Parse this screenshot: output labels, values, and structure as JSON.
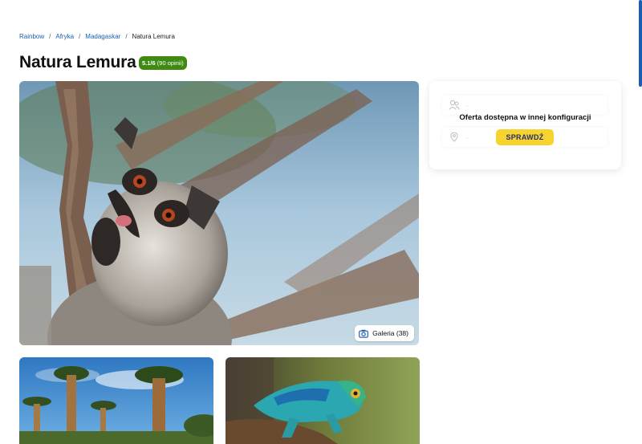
{
  "breadcrumb": {
    "items": [
      "Rainbow",
      "Afryka",
      "Madagaskar"
    ],
    "separator": "/",
    "current": "Natura Lemura"
  },
  "page": {
    "title": "Natura Lemura",
    "rating_score": "5.1/6",
    "rating_count": "(90 opinii)"
  },
  "gallery": {
    "button_label": "Galeria (38)",
    "icon": "camera-icon"
  },
  "offer": {
    "row1_placeholder": "-",
    "row2_placeholder": "-",
    "message": "Oferta dostępna w innej konfiguracji",
    "button_label": "SPRAWDŹ",
    "icons": [
      "people-icon",
      "location-icon"
    ]
  },
  "colors": {
    "link": "#1c5fb0",
    "rating_bg": "#3f8a12",
    "button_bg": "#f7d330",
    "button_text": "#23306b",
    "scrollbar": "#1c5fb0"
  }
}
